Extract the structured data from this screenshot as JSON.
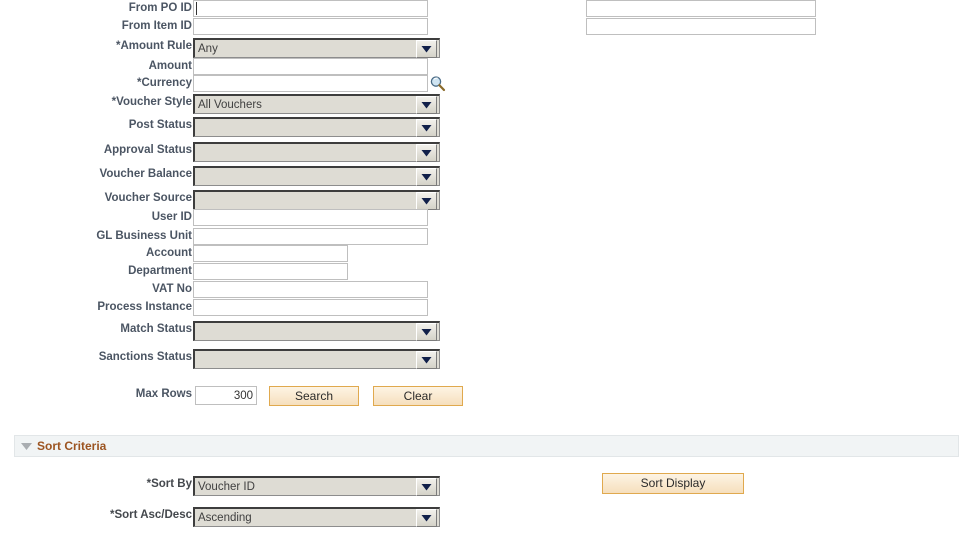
{
  "colors": {
    "label": "#4b5563",
    "group_title": "#9c5421",
    "button_border": "#e0a94e",
    "button_fill_top": "#fdf4e4",
    "button_fill_bottom": "#f6dfbd",
    "select_fill": "#dedcd4",
    "input_border": "#bfbfbf",
    "group_header_bg": "#f1f4f5"
  },
  "search_criteria": {
    "fields": [
      {
        "label": "From PO ID",
        "type": "text",
        "value": "",
        "placeholder": "",
        "width": "w235",
        "focused": true
      },
      {
        "label": "From Item ID",
        "type": "text",
        "value": "",
        "placeholder": "",
        "width": "w235",
        "focused": false
      },
      {
        "label": "*Amount Rule",
        "type": "select",
        "value": "Any"
      },
      {
        "label": "Amount",
        "type": "text",
        "value": "",
        "placeholder": "",
        "width": "w235",
        "focused": false
      },
      {
        "label": "*Currency",
        "type": "text",
        "value": "",
        "placeholder": "",
        "width": "w235",
        "focused": false,
        "lookup": "lookup-icon"
      },
      {
        "label": "*Voucher Style",
        "type": "select",
        "value": "All Vouchers"
      },
      {
        "label": "Post Status",
        "type": "select",
        "value": ""
      },
      {
        "label": "Approval Status",
        "type": "select",
        "value": ""
      },
      {
        "label": "Voucher Balance",
        "type": "select",
        "value": ""
      },
      {
        "label": "Voucher Source",
        "type": "select",
        "value": ""
      },
      {
        "label": "User ID",
        "type": "text",
        "value": "",
        "placeholder": "",
        "width": "w235",
        "focused": false
      },
      {
        "label": "GL Business Unit",
        "type": "text",
        "value": "",
        "placeholder": "",
        "width": "w235",
        "focused": false
      },
      {
        "label": "Account",
        "type": "text",
        "value": "",
        "placeholder": "",
        "width": "w155",
        "focused": false
      },
      {
        "label": "Department",
        "type": "text",
        "value": "",
        "placeholder": "",
        "width": "w155",
        "focused": false
      },
      {
        "label": "VAT No",
        "type": "text",
        "value": "",
        "placeholder": "",
        "width": "w235",
        "focused": false
      },
      {
        "label": "Process Instance",
        "type": "text",
        "value": "",
        "placeholder": "",
        "width": "w235",
        "focused": false
      },
      {
        "label": "Match Status",
        "type": "select",
        "value": ""
      },
      {
        "label": "Sanctions Status",
        "type": "select",
        "value": ""
      }
    ],
    "extra_top_fields": [
      {
        "value": "",
        "placeholder": ""
      },
      {
        "value": "",
        "placeholder": ""
      }
    ],
    "max_rows": {
      "label": "Max Rows",
      "value": "300"
    },
    "buttons": {
      "search": "Search",
      "clear": "Clear"
    }
  },
  "sort_criteria": {
    "title": "Sort Criteria",
    "twisty_icon": "triangle-down-icon",
    "expanded": true,
    "sort_by": {
      "label": "*Sort By",
      "value": "Voucher ID"
    },
    "sort_order": {
      "label": "*Sort Asc/Desc",
      "value": "Ascending"
    },
    "sort_display_button": "Sort Display"
  }
}
